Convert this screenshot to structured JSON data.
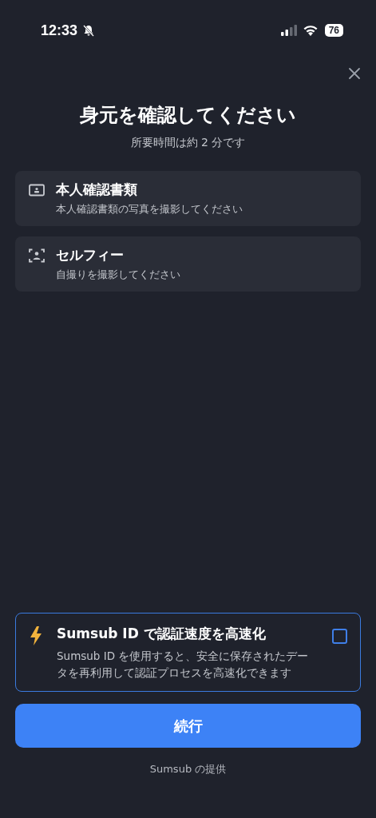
{
  "status_bar": {
    "time": "12:33",
    "battery": "76"
  },
  "title": "身元を確認してください",
  "subtitle": "所要時間は約 2 分です",
  "steps": [
    {
      "kind": "document",
      "title": "本人確認書類",
      "description": "本人確認書類の写真を撮影してください"
    },
    {
      "kind": "selfie",
      "title": "セルフィー",
      "description": "自撮りを撮影してください"
    }
  ],
  "sumsub_id": {
    "title": "Sumsub ID で認証速度を高速化",
    "description": "Sumsub ID を使用すると、安全に保存されたデータを再利用して認証プロセスを高速化できます",
    "checked": false
  },
  "continue_button": "続行",
  "footer": "Sumsub の提供"
}
